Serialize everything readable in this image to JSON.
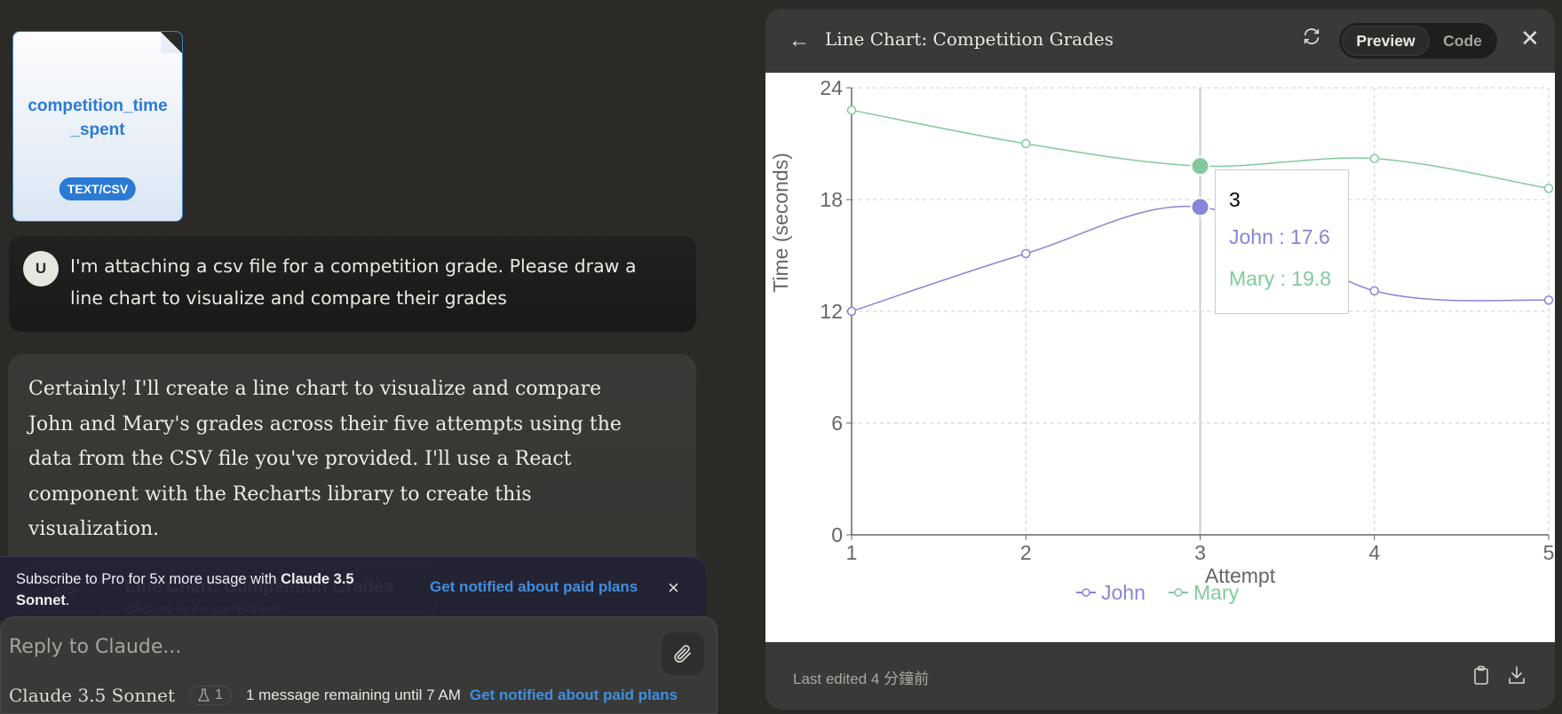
{
  "attachment": {
    "file_name": "competition_time_spent",
    "file_type": "TEXT/CSV"
  },
  "user_message": {
    "avatar_letter": "U",
    "text": "I'm attaching a csv file for a competition grade.  Please draw a line chart to visualize and compare their grades"
  },
  "assistant_message": {
    "text": "Certainly! I'll create a line chart to visualize and compare John and Mary's grades across their five attempts using the data from the CSV file you've provided. I'll use a React component with the Recharts library to create this visualization.",
    "artifact_title": "Line Chart: Competition Grades",
    "artifact_subtitle": "Click to open component",
    "artifact_icon": "</>"
  },
  "banner": {
    "text_prefix": "Subscribe to Pro for 5x more usage with ",
    "text_bold": "Claude 3.5 Sonnet",
    "text_suffix": ".",
    "link": "Get notified about paid plans",
    "close": "×"
  },
  "composer": {
    "placeholder": "Reply to Claude...",
    "model": "Claude 3.5 Sonnet",
    "flask_count": "1",
    "remaining": "1 message remaining until 7 AM",
    "paid_link": "Get notified about paid plans"
  },
  "panel": {
    "title": "Line Chart: Competition Grades",
    "tabs": [
      "Preview",
      "Code"
    ],
    "active_tab": "Preview",
    "last_edited": "Last edited 4 分鐘前"
  },
  "tooltip": {
    "label": "3",
    "john": "John : 17.6",
    "mary": "Mary : 19.8"
  },
  "colors": {
    "john": "#8884d8",
    "mary": "#82ca9d"
  },
  "chart_data": {
    "type": "line",
    "title": "",
    "xlabel": "Attempt",
    "ylabel": "Time (seconds)",
    "x": [
      1,
      2,
      3,
      4,
      5
    ],
    "x_ticks": [
      "1",
      "2",
      "3",
      "4",
      "5"
    ],
    "y_ticks": [
      "0",
      "6",
      "12",
      "18",
      "24"
    ],
    "ylim": [
      0,
      24
    ],
    "grid": true,
    "legend": "bottom-center",
    "series": [
      {
        "name": "John",
        "values": [
          12.0,
          15.1,
          17.6,
          13.1,
          12.6
        ]
      },
      {
        "name": "Mary",
        "values": [
          22.8,
          21.0,
          19.8,
          20.2,
          18.6
        ]
      }
    ],
    "active_index": 2
  }
}
